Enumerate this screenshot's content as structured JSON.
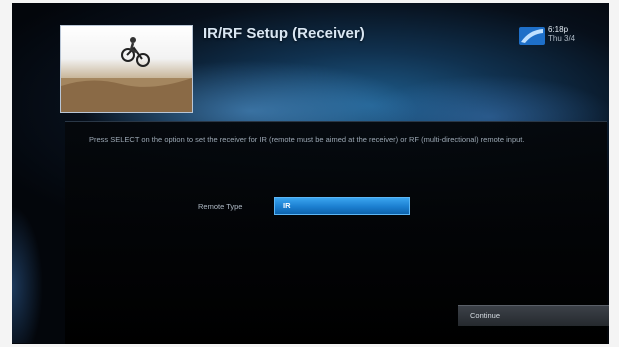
{
  "screen": {
    "title": "IR/RF Setup (Receiver)",
    "clock": {
      "time": "6:18p",
      "date": "Thu 3/4"
    },
    "description": "Press SELECT on the option to set the receiver for IR (remote must be aimed at the receiver) or RF (multi-directional) remote input.",
    "remote_type": {
      "label": "Remote Type",
      "value": "IR"
    },
    "continue_label": "Continue",
    "icons": {
      "logo": "provider-logo-icon",
      "thumbnail": "bmx-rider-thumbnail"
    }
  },
  "colors": {
    "accent": "#1b7fd0",
    "background": "#070f1a",
    "panel": "#050505",
    "text": "#9ca8b4"
  }
}
